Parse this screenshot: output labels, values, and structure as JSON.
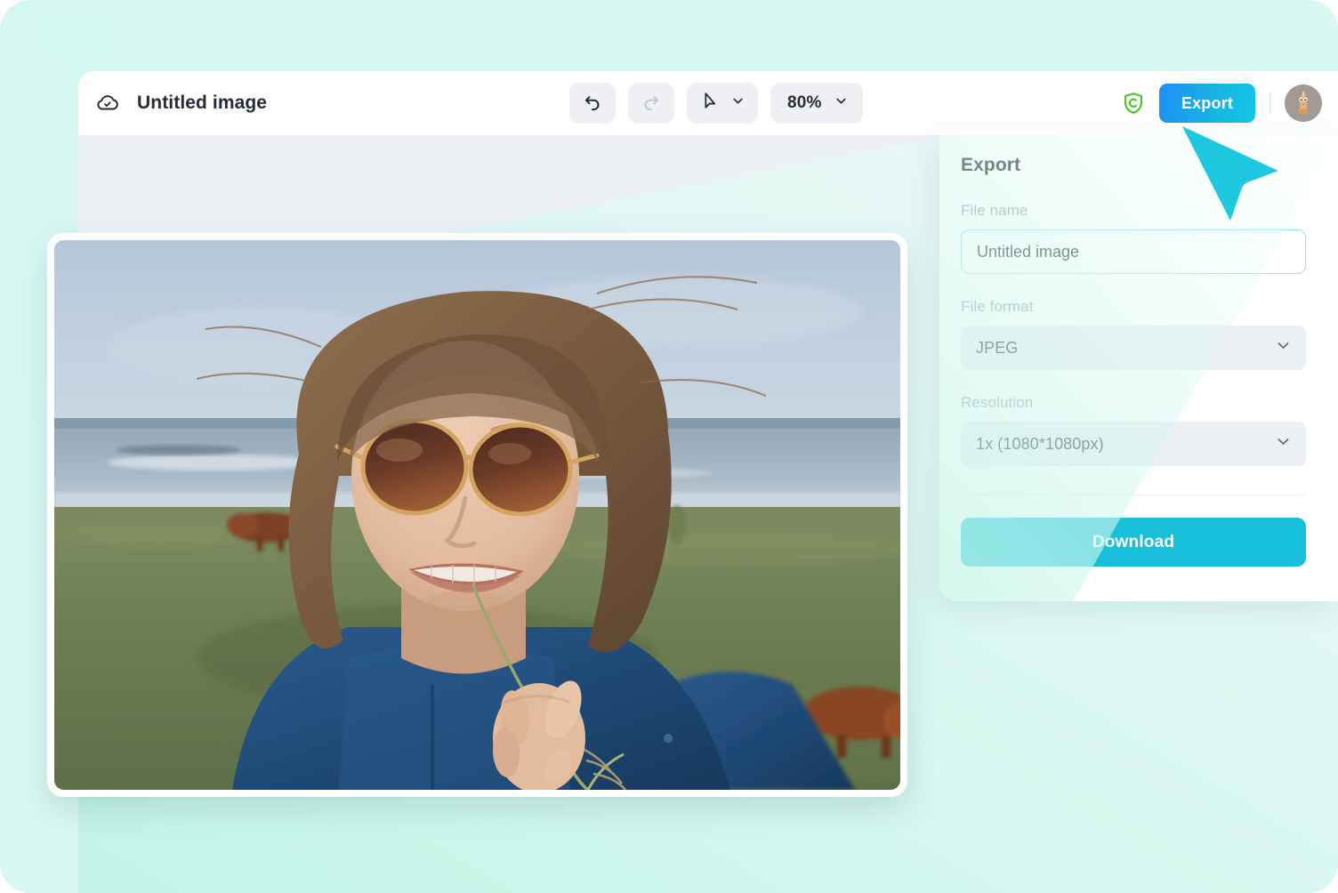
{
  "app": {
    "document_title": "Untitled image",
    "cloud_icon": "cloud-check-icon"
  },
  "toolbar": {
    "undo_icon": "undo-arrow-icon",
    "redo_icon": "redo-arrow-icon",
    "cursor_tool_icon": "cursor-pointer-icon",
    "tool_chevron_icon": "chevron-down-icon",
    "zoom_level": "80%",
    "zoom_chevron_icon": "chevron-down-icon",
    "shield_icon": "shield-c-icon",
    "export_label": "Export",
    "avatar_icon": "user-avatar"
  },
  "export_panel": {
    "title": "Export",
    "file_name": {
      "label": "File name",
      "value": "Untitled image",
      "placeholder": "Untitled image"
    },
    "file_format": {
      "label": "File format",
      "value": "JPEG",
      "chevron_icon": "chevron-down-icon"
    },
    "resolution": {
      "label": "Resolution",
      "value": "1x (1080*1080px)",
      "chevron_icon": "chevron-down-icon"
    },
    "download_label": "Download"
  },
  "canvas": {
    "image_alt": "portrait of woman with round sunglasses in a coastal field with cows"
  },
  "colors": {
    "page_background": "#d6f7ef",
    "canvas_background": "#edf1f5",
    "toolbar_background": "#fdfdfe",
    "panel_background": "#ffffff",
    "accent_cyan": "#18bfd8",
    "export_gradient_from": "#1f8ff5",
    "export_gradient_to": "#13c6e6",
    "input_border": "#8fe3e8",
    "shield_green": "#4dc323",
    "label_gray": "#97a0ab",
    "text_dark": "#262b35",
    "cursor_cyan": "#1ec8de"
  }
}
